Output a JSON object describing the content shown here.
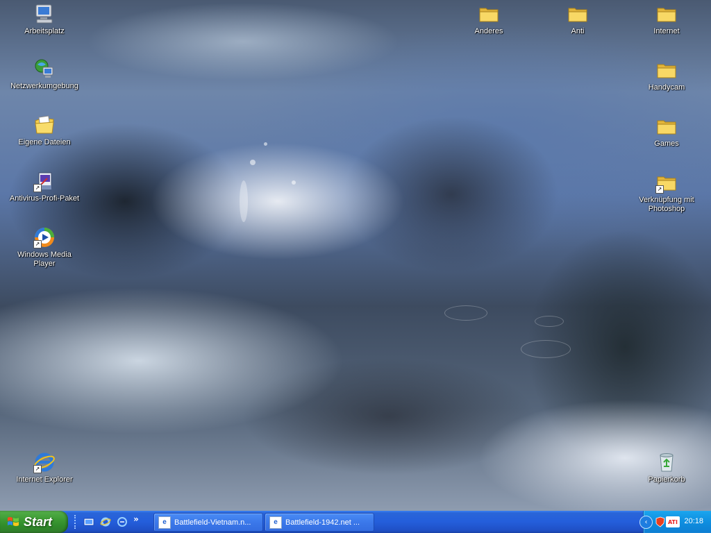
{
  "desktop": {
    "left_icons": [
      {
        "label": "Arbeitsplatz",
        "icon": "my-computer-icon"
      },
      {
        "label": "Netzwerkumgebung",
        "icon": "network-places-icon"
      },
      {
        "label": "Eigene Dateien",
        "icon": "my-documents-icon"
      },
      {
        "label": "Antivirus-Profi-Paket",
        "icon": "antivirus-icon"
      },
      {
        "label": "Windows Media Player",
        "icon": "media-player-icon"
      },
      {
        "label": "Internet Explorer",
        "icon": "internet-explorer-icon"
      }
    ],
    "right_icons": [
      {
        "label": "Anderes",
        "icon": "folder-icon"
      },
      {
        "label": "Anti",
        "icon": "folder-icon"
      },
      {
        "label": "Internet",
        "icon": "folder-icon"
      },
      {
        "label": "Handycam",
        "icon": "folder-icon"
      },
      {
        "label": "Games",
        "icon": "folder-icon"
      },
      {
        "label": "Verknüpfung mit Photoshop",
        "icon": "folder-shortcut-icon"
      },
      {
        "label": "Papierkorb",
        "icon": "recycle-bin-icon"
      }
    ]
  },
  "taskbar": {
    "start_label": "Start",
    "quick_launch_more": "»",
    "tasks": [
      {
        "label": "Battlefield-Vietnam.n..."
      },
      {
        "label": "Battlefield-1942.net ..."
      }
    ],
    "tray": {
      "clock": "20:18",
      "ati_label": "ATI"
    }
  },
  "colors": {
    "taskbar_blue": "#245edb",
    "start_green": "#3c9a33",
    "tray_blue": "#0f8fe0",
    "folder_yellow": "#f4cf4f"
  }
}
